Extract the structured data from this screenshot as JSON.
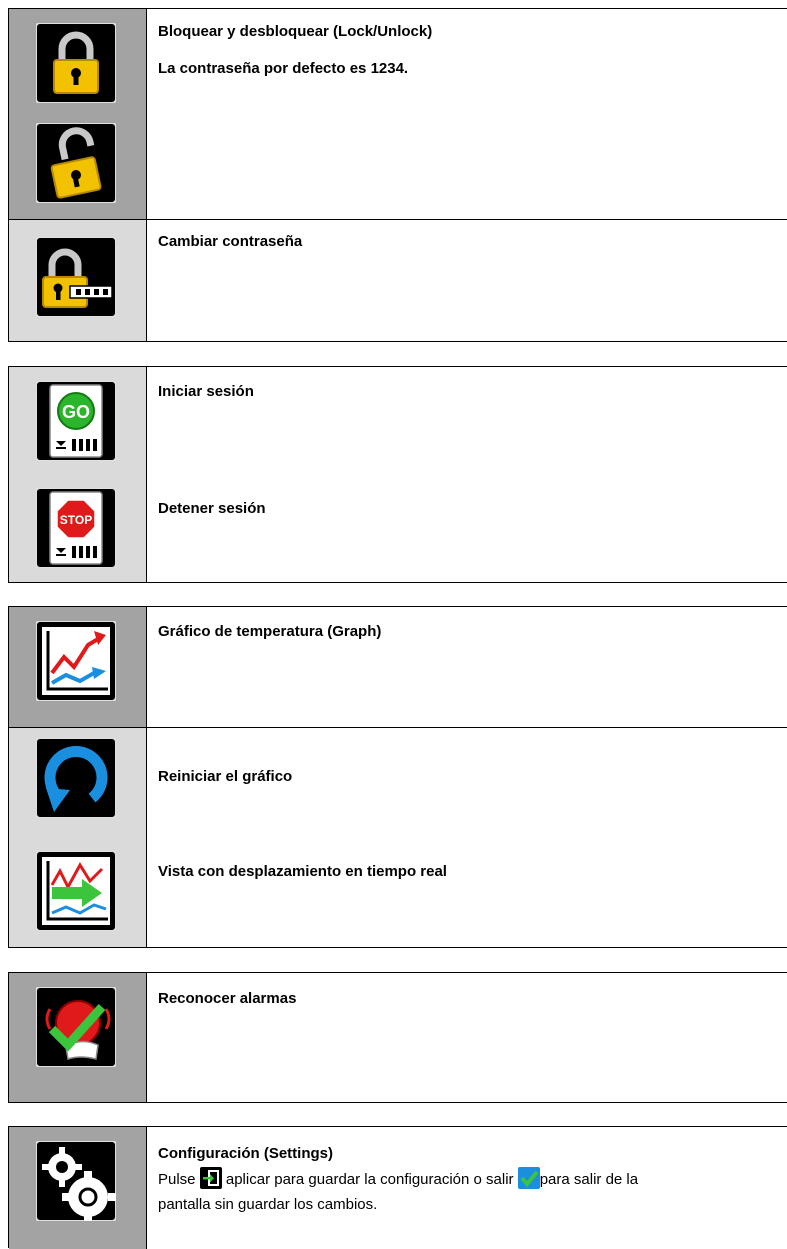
{
  "section_lock": {
    "lock_title": "Bloquear y desbloquear (Lock/Unlock)",
    "lock_note": "La contraseña por defecto es 1234.",
    "change_password": "Cambiar contraseña",
    "icons": [
      "lock-closed-icon",
      "lock-open-icon",
      "lock-password-icon"
    ]
  },
  "section_session": {
    "start": "Iniciar sesión",
    "stop": "Detener sesión",
    "icons": [
      "go-session-icon",
      "stop-session-icon"
    ],
    "go_text": "GO",
    "stop_text": "STOP"
  },
  "section_graph": {
    "graph": "Gráfico de temperatura (Graph)",
    "reset": "Reiniciar el gráfico",
    "scroll": "Vista con desplazamiento en tiempo real",
    "icons": [
      "temperature-graph-icon",
      "reset-graph-icon",
      "scroll-view-icon"
    ]
  },
  "section_alarm": {
    "ack": "Reconocer alarmas",
    "icons": [
      "acknowledge-alarm-icon"
    ]
  },
  "section_settings": {
    "title": "Configuración (Settings)",
    "desc_1": "Pulse",
    "desc_2": "aplicar para guardar la configuración o salir",
    "desc_3": "para salir de la",
    "desc_4": "pantalla sin guardar los cambios.",
    "icons": [
      "settings-gears-icon",
      "apply-exit-icon",
      "checkmark-icon"
    ]
  },
  "colors": {
    "icon_bg": "#000000",
    "lock_yellow": "#f2c200",
    "go_green": "#2bb52b",
    "stop_red": "#e01a1a",
    "check_green": "#3cc43c",
    "blue": "#1a8fe0"
  }
}
